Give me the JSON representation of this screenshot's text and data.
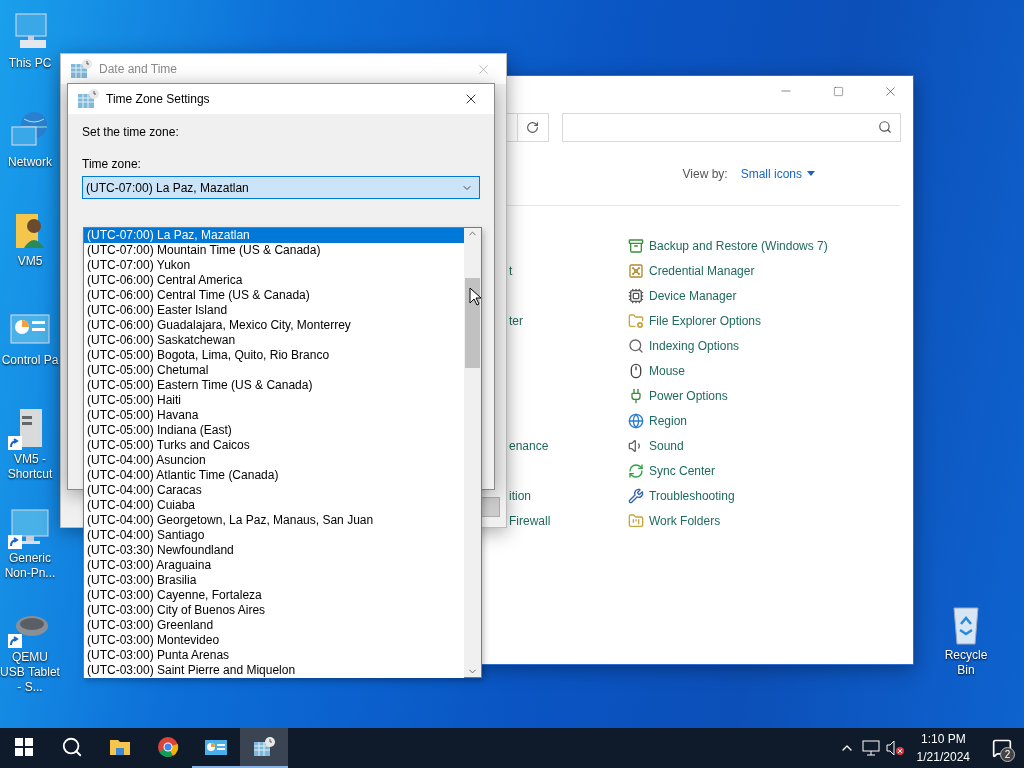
{
  "desktop_icons": [
    {
      "kind": "computer",
      "label": "This PC",
      "shortcut": false
    },
    {
      "kind": "network",
      "label": "Network",
      "shortcut": false
    },
    {
      "kind": "userfolder",
      "label": "VM5",
      "shortcut": false
    },
    {
      "kind": "panel",
      "label": "Control Pa",
      "shortcut": false
    },
    {
      "kind": "server",
      "label": "VM5 - Shortcut",
      "shortcut": true
    },
    {
      "kind": "monitor",
      "label": "Generic Non-Pn...",
      "shortcut": true
    },
    {
      "kind": "mouse",
      "label": "QEMU USB Tablet - S...",
      "shortcut": true
    }
  ],
  "recycle_bin": {
    "label": "Recycle Bin"
  },
  "control_panel": {
    "view_by_label": "View by:",
    "view_by_value": "Small icons",
    "rows": [
      {
        "right": {
          "kind": "backup",
          "label": "Backup and Restore (Windows 7)"
        }
      },
      {
        "left": "t",
        "right": {
          "kind": "credentials",
          "label": "Credential Manager"
        }
      },
      {
        "right": {
          "kind": "devices",
          "label": "Device Manager"
        }
      },
      {
        "left": "ter",
        "right": {
          "kind": "folders",
          "label": "File Explorer Options"
        }
      },
      {
        "right": {
          "kind": "indexing",
          "label": "Indexing Options"
        }
      },
      {
        "right": {
          "kind": "mouse",
          "label": "Mouse"
        }
      },
      {
        "right": {
          "kind": "power",
          "label": "Power Options"
        }
      },
      {
        "right": {
          "kind": "region",
          "label": "Region"
        }
      },
      {
        "left": "enance",
        "right": {
          "kind": "sound",
          "label": "Sound"
        }
      },
      {
        "right": {
          "kind": "sync",
          "label": "Sync Center"
        }
      },
      {
        "left": "ition",
        "right": {
          "kind": "troubleshoot",
          "label": "Troubleshooting"
        }
      },
      {
        "left": "Firewall",
        "right": {
          "kind": "work",
          "label": "Work Folders"
        }
      }
    ]
  },
  "date_time_window": {
    "title": "Date and Time"
  },
  "time_zone_dialog": {
    "title": "Time Zone Settings",
    "prompt": "Set the time zone:",
    "field_label": "Time zone:",
    "value": "(UTC-07:00) La Paz, Mazatlan",
    "options": [
      {
        "label": "(UTC-07:00) La Paz, Mazatlan",
        "selected": true
      },
      {
        "label": "(UTC-07:00) Mountain Time (US & Canada)",
        "selected": false
      },
      {
        "label": "(UTC-07:00) Yukon",
        "selected": false
      },
      {
        "label": "(UTC-06:00) Central America",
        "selected": false
      },
      {
        "label": "(UTC-06:00) Central Time (US & Canada)",
        "selected": false
      },
      {
        "label": "(UTC-06:00) Easter Island",
        "selected": false
      },
      {
        "label": "(UTC-06:00) Guadalajara, Mexico City, Monterrey",
        "selected": false
      },
      {
        "label": "(UTC-06:00) Saskatchewan",
        "selected": false
      },
      {
        "label": "(UTC-05:00) Bogota, Lima, Quito, Rio Branco",
        "selected": false
      },
      {
        "label": "(UTC-05:00) Chetumal",
        "selected": false
      },
      {
        "label": "(UTC-05:00) Eastern Time (US & Canada)",
        "selected": false
      },
      {
        "label": "(UTC-05:00) Haiti",
        "selected": false
      },
      {
        "label": "(UTC-05:00) Havana",
        "selected": false
      },
      {
        "label": "(UTC-05:00) Indiana (East)",
        "selected": false
      },
      {
        "label": "(UTC-05:00) Turks and Caicos",
        "selected": false
      },
      {
        "label": "(UTC-04:00) Asuncion",
        "selected": false
      },
      {
        "label": "(UTC-04:00) Atlantic Time (Canada)",
        "selected": false
      },
      {
        "label": "(UTC-04:00) Caracas",
        "selected": false
      },
      {
        "label": "(UTC-04:00) Cuiaba",
        "selected": false
      },
      {
        "label": "(UTC-04:00) Georgetown, La Paz, Manaus, San Juan",
        "selected": false
      },
      {
        "label": "(UTC-04:00) Santiago",
        "selected": false
      },
      {
        "label": "(UTC-03:30) Newfoundland",
        "selected": false
      },
      {
        "label": "(UTC-03:00) Araguaina",
        "selected": false
      },
      {
        "label": "(UTC-03:00) Brasilia",
        "selected": false
      },
      {
        "label": "(UTC-03:00) Cayenne, Fortaleza",
        "selected": false
      },
      {
        "label": "(UTC-03:00) City of Buenos Aires",
        "selected": false
      },
      {
        "label": "(UTC-03:00) Greenland",
        "selected": false
      },
      {
        "label": "(UTC-03:00) Montevideo",
        "selected": false
      },
      {
        "label": "(UTC-03:00) Punta Arenas",
        "selected": false
      },
      {
        "label": "(UTC-03:00) Saint Pierre and Miquelon",
        "selected": false
      }
    ]
  },
  "taskbar": {
    "apps": [
      {
        "kind": "explorer",
        "running": false,
        "selected": false
      },
      {
        "kind": "chrome",
        "running": false,
        "selected": false
      },
      {
        "kind": "panel",
        "running": true,
        "selected": false
      },
      {
        "kind": "clock",
        "running": true,
        "selected": true
      }
    ],
    "time": "1:10 PM",
    "date": "1/21/2024",
    "notification_count": "2"
  }
}
